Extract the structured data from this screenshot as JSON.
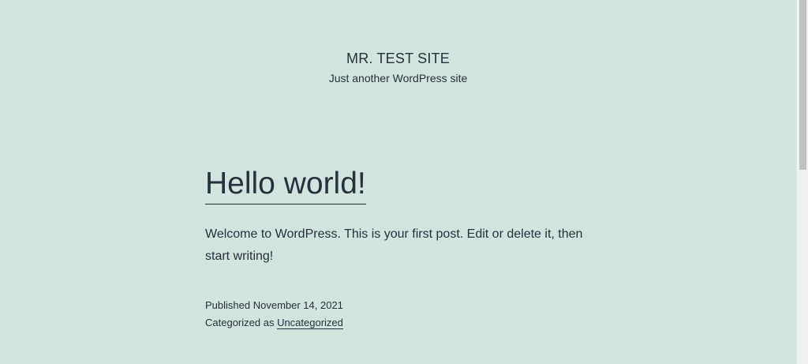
{
  "site": {
    "title": "MR. TEST SITE",
    "description": "Just another WordPress site"
  },
  "post": {
    "title": "Hello world!",
    "content": "Welcome to WordPress. This is your first post. Edit or delete it, then start writing!",
    "published_prefix": "Published ",
    "published_date": "November 14, 2021",
    "categorized_prefix": "Categorized as ",
    "category": "Uncategorized"
  },
  "colors": {
    "background": "#d1e4dd",
    "text": "#28303d"
  }
}
